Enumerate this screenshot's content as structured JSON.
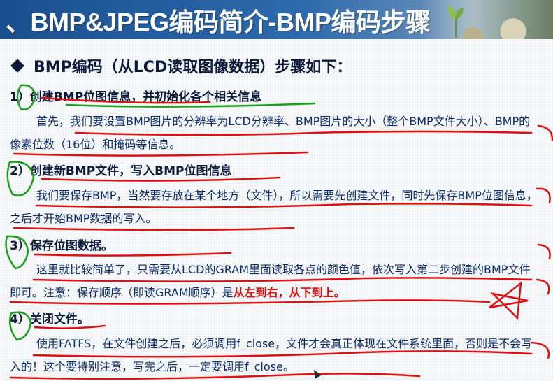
{
  "slide": {
    "title": "、BMP&JPEG编码简介-BMP编码步骤",
    "heading": "BMP编码（从LCD读取图像数据）步骤如下：",
    "steps": [
      {
        "label": "1）创建BMP位图信息，并初始化各个相关信息",
        "text": "首先，我们要设置BMP图片的分辨率为LCD分辨率、BMP图片的大小（整个BMP文件大小）、BMP的像素位数（16位）和掩码等信息。"
      },
      {
        "label": "2）创建新BMP文件，写入BMP位图信息",
        "text": "我们要保存BMP，当然要存放在某个地方（文件），所以需要先创建文件，同时先保存BMP位图信息，之后才开始BMP数据的写入。"
      },
      {
        "label": "3）保存位图数据。",
        "text": "这里就比较简单了，只需要从LCD的GRAM里面读取各点的颜色值，依次写入第二步创建的BMP文件即可。注意：保存顺序（即读GRAM顺序）是",
        "emphasis": "从左到右，从下到上。"
      },
      {
        "label": "4）关闭文件。",
        "text": "使用FATFS，在文件创建之后，必须调用f_close，文件才会真正体现在文件系统里面，否则是不会写入的！这个要特别注意，写完之后，一定要调用f_close。"
      }
    ]
  },
  "colors": {
    "banner": "#2e6aad",
    "text": "#0c2c6b",
    "emphasis": "#e01010",
    "annotation_red": "#e01010",
    "annotation_green": "#1aa01a"
  }
}
